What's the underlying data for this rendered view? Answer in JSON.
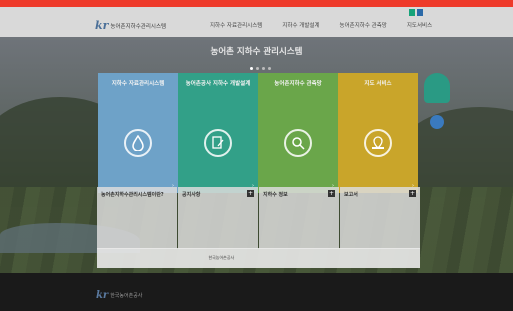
{
  "topbar_color": "#ee3a2a",
  "util": {
    "link1": "",
    "link2": ""
  },
  "brand": {
    "mark": "kr",
    "name": "농어촌지하수관리시스템"
  },
  "nav": [
    "지하수 자료관리시스템",
    "지하수 개발설계",
    "농어촌지하수 관측망",
    "지도서비스"
  ],
  "hero": {
    "title": "농어촌 지하수 관리시스템",
    "subtitle": ""
  },
  "cards": [
    {
      "title": "지하수 자료관리시스템",
      "sub": "",
      "icon": "water-drop-icon",
      "color": "#6ea2c8"
    },
    {
      "title": "농어촌공사 지하수 개발설계",
      "sub": "",
      "icon": "document-pen-icon",
      "color": "#32a088"
    },
    {
      "title": "농어촌지하수 관측망",
      "sub": "",
      "icon": "magnifier-icon",
      "color": "#6aa64a"
    },
    {
      "title": "지도 서비스",
      "sub": "",
      "icon": "map-pin-icon",
      "color": "#c9a52a"
    }
  ],
  "badge": {
    "line1": "",
    "line2": ""
  },
  "panels": [
    {
      "title": "농어촌지하수관리시스템이란?",
      "rows": []
    },
    {
      "title": "공지사항",
      "rows": []
    },
    {
      "title": "지하수 정보",
      "rows": []
    },
    {
      "title": "보고서",
      "rows": []
    }
  ],
  "partners": [
    "",
    "한국농어촌공사",
    "",
    ""
  ],
  "footer": {
    "name": "한국농어촌공사",
    "address": "",
    "copyright": ""
  }
}
